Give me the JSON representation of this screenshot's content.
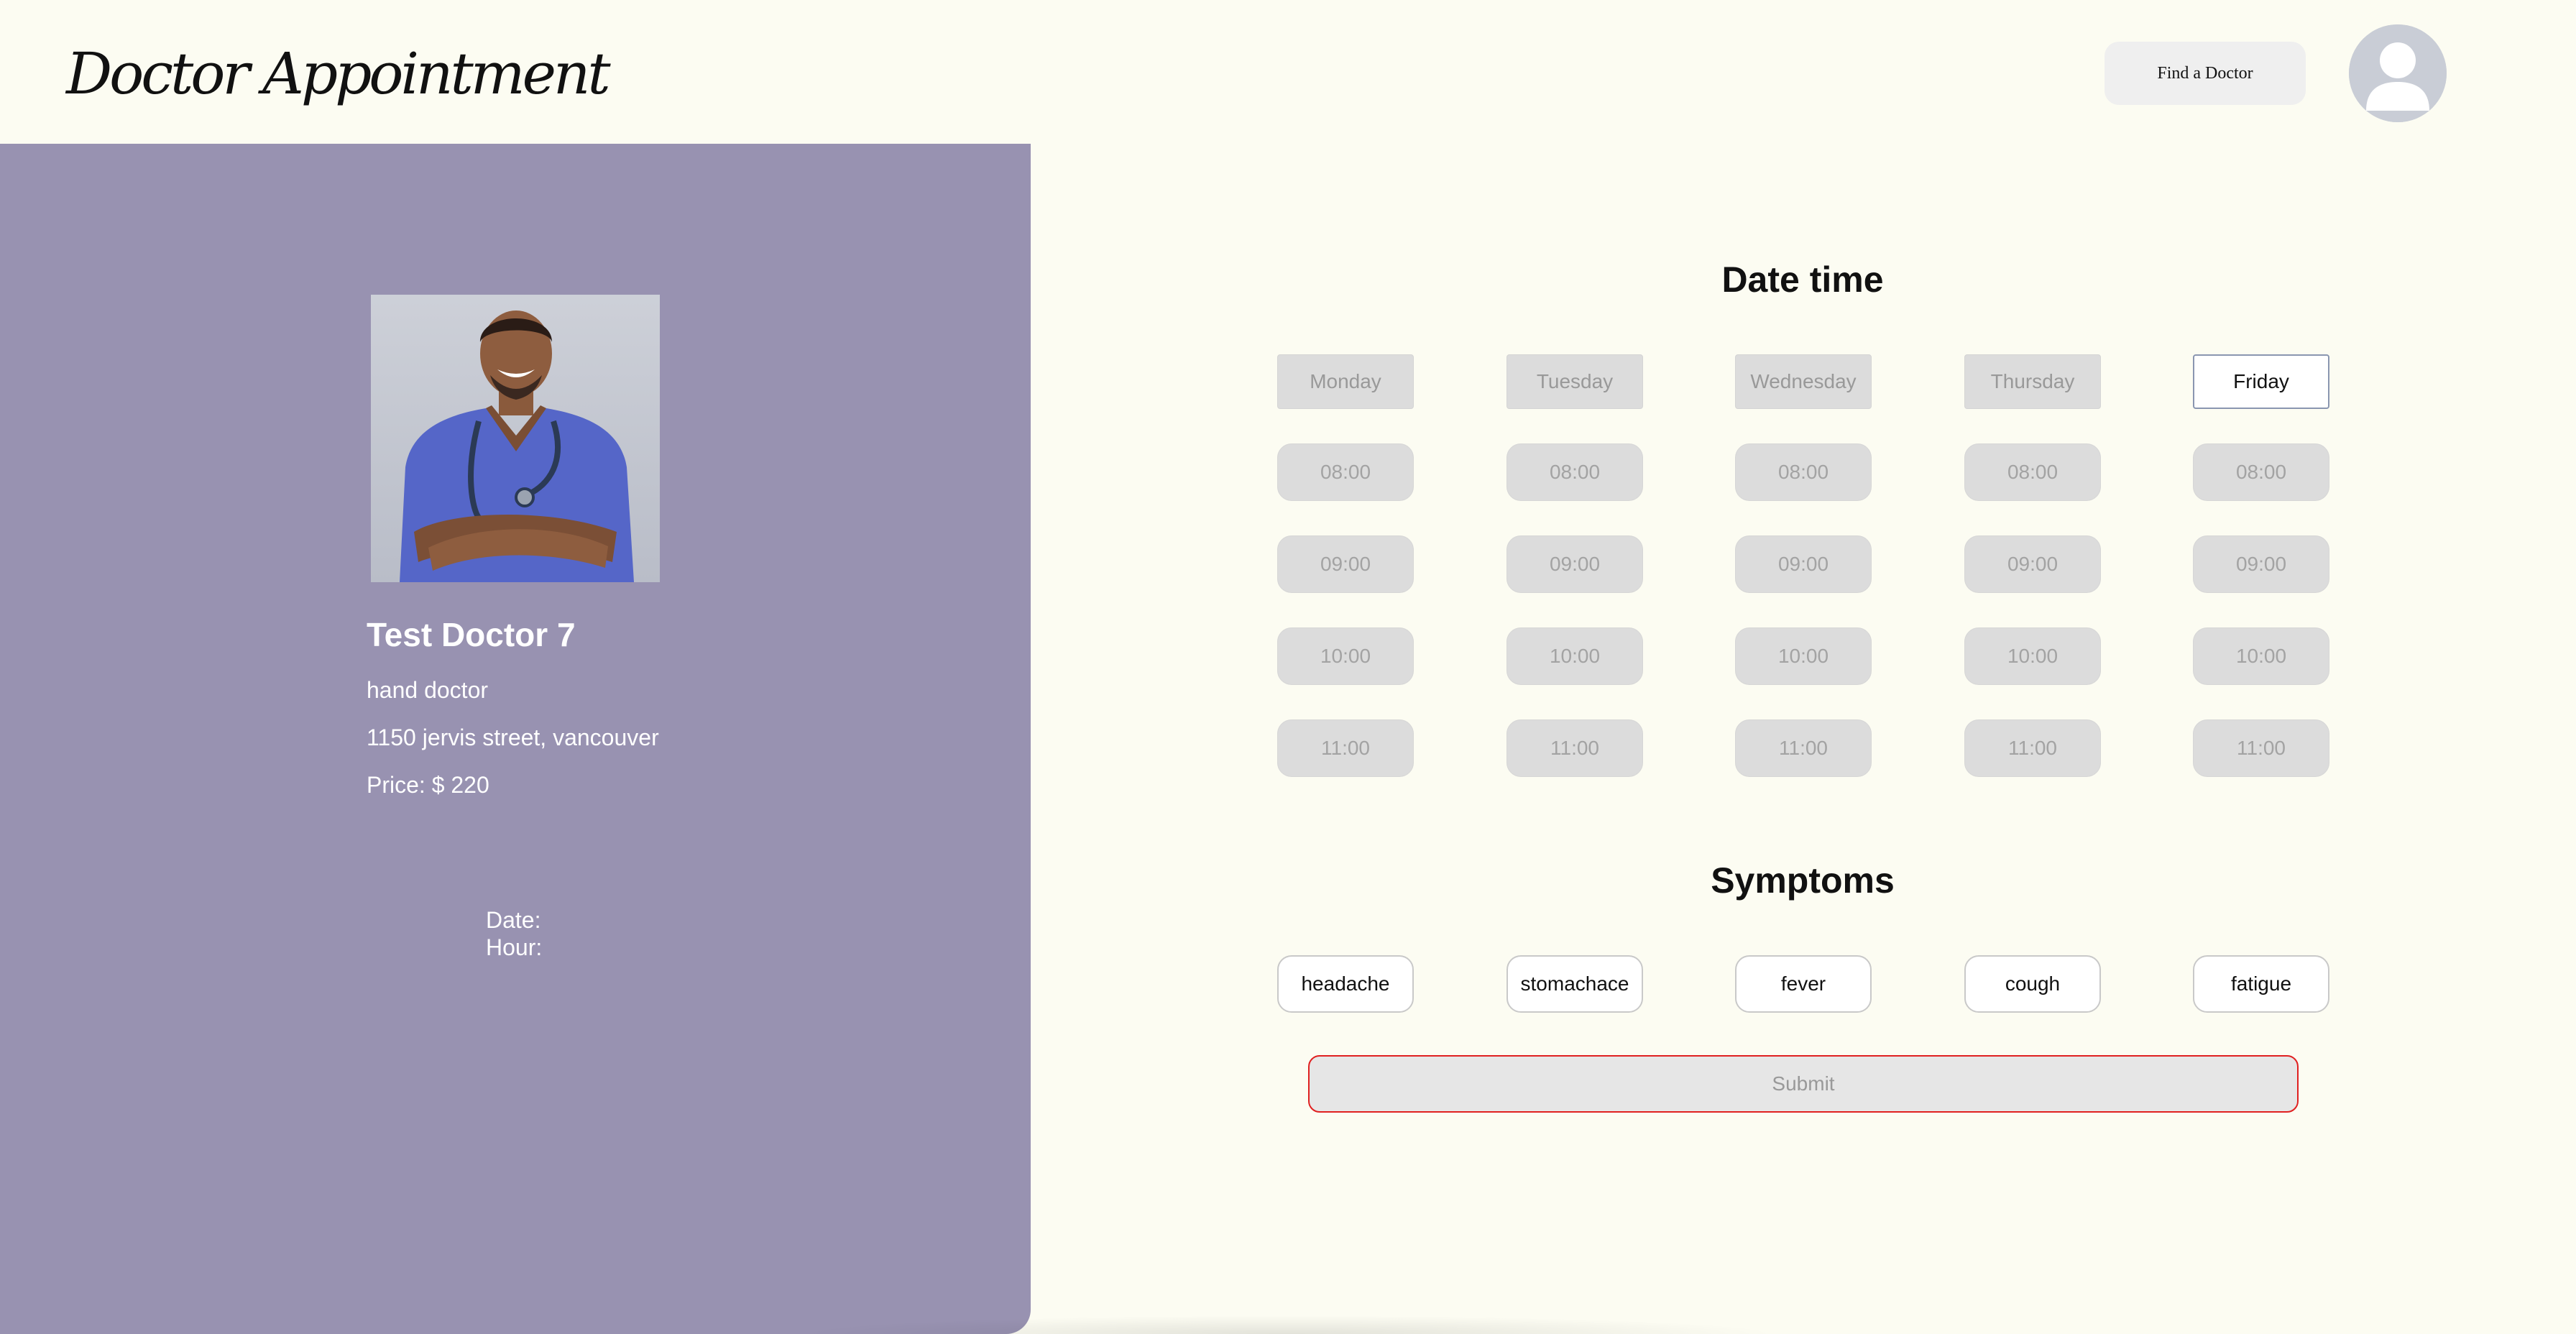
{
  "header": {
    "logo_text": "Doctor Appointment",
    "find_doctor_label": "Find a Doctor",
    "avatar_icon": "user-avatar-icon"
  },
  "doctor": {
    "photo_icon": "doctor-portrait-photo",
    "name": "Test Doctor 7",
    "specialty": "hand doctor",
    "address": "1150 jervis street, vancouver",
    "price": "Price: $ 220"
  },
  "selection": {
    "date_label": "Date:",
    "hour_label": "Hour:"
  },
  "schedule": {
    "title": "Date time",
    "days": [
      {
        "label": "Monday",
        "active": false
      },
      {
        "label": "Tuesday",
        "active": false
      },
      {
        "label": "Wednesday",
        "active": false
      },
      {
        "label": "Thursday",
        "active": false
      },
      {
        "label": "Friday",
        "active": true
      }
    ],
    "times": [
      "08:00",
      "09:00",
      "10:00",
      "11:00"
    ]
  },
  "symptoms": {
    "title": "Symptoms",
    "items": [
      "headache",
      "stomachace",
      "fever",
      "cough",
      "fatigue"
    ]
  },
  "submit_label": "Submit",
  "colors": {
    "page_bg": "#fcfcf2",
    "panel_bg": "#9892b1",
    "submit_border": "#e02020",
    "active_day_border": "#8a96b0"
  }
}
